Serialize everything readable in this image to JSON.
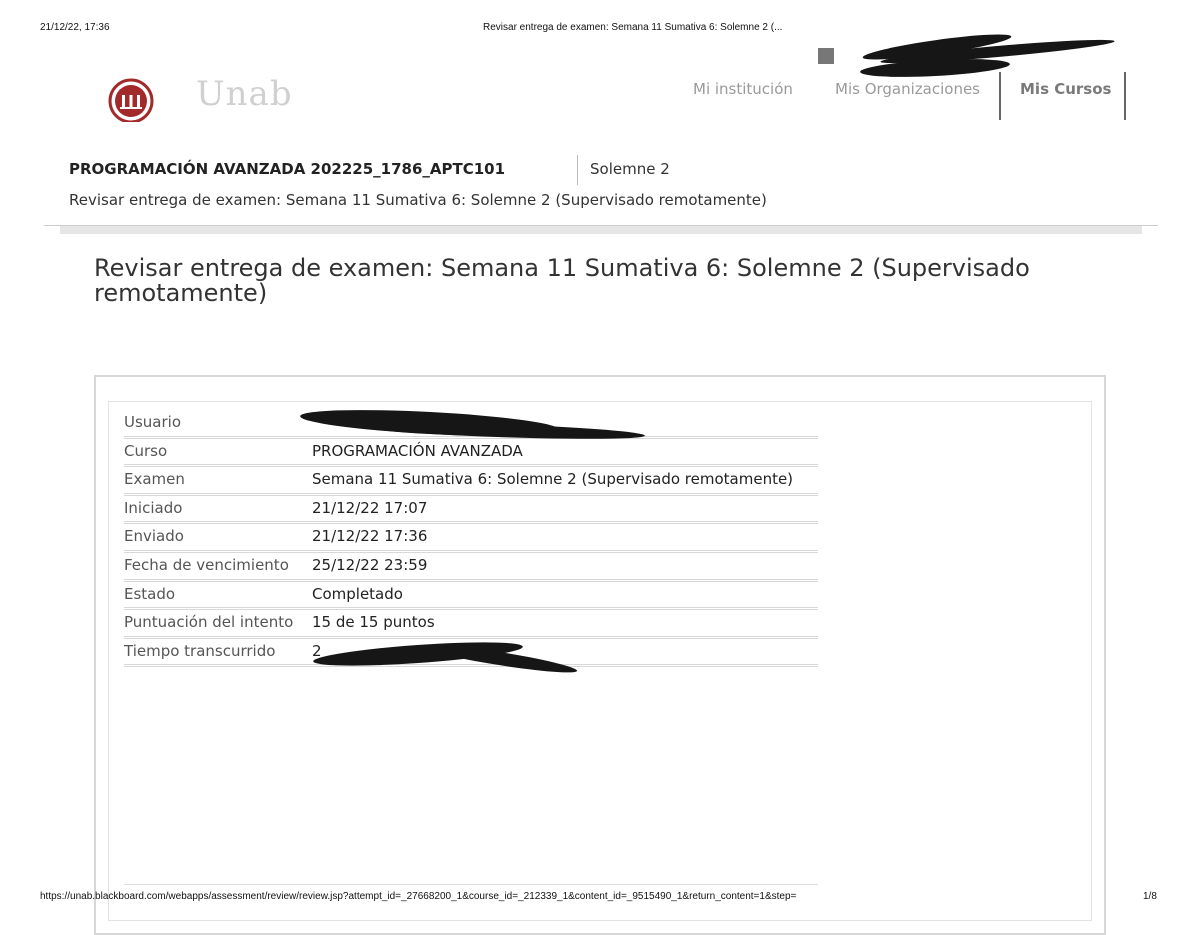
{
  "print": {
    "datetime": "21/12/22, 17:36",
    "title": "Revisar entrega de examen: Semana 11 Sumativa 6: Solemne 2 (...",
    "url": "https://unab.blackboard.com/webapps/assessment/review/review.jsp?attempt_id=_27668200_1&course_id=_212339_1&content_id=_9515490_1&return_content=1&step=",
    "page": "1/8"
  },
  "brand": {
    "logo_text": "Unab",
    "seal_color": "#a32a2a"
  },
  "nav": {
    "institution": "Mi institución",
    "organizations": "Mis Organizaciones",
    "courses": "Mis Cursos"
  },
  "breadcrumb": {
    "course": "PROGRAMACIÓN AVANZADA 202225_1786_APTC101",
    "item": "Solemne 2",
    "page": "Revisar entrega de examen: Semana 11 Sumativa 6: Solemne 2 (Supervisado remotamente)"
  },
  "page_title": "Revisar entrega de examen: Semana 11 Sumativa 6: Solemne 2 (Supervisado remotamente)",
  "details": [
    {
      "label": "Usuario",
      "value": ""
    },
    {
      "label": "Curso",
      "value": "PROGRAMACIÓN AVANZADA"
    },
    {
      "label": "Examen",
      "value": "Semana 11 Sumativa 6: Solemne 2 (Supervisado remotamente)"
    },
    {
      "label": "Iniciado",
      "value": "21/12/22 17:07"
    },
    {
      "label": "Enviado",
      "value": "21/12/22 17:36"
    },
    {
      "label": "Fecha de vencimiento",
      "value": "25/12/22 23:59"
    },
    {
      "label": "Estado",
      "value": "Completado"
    },
    {
      "label": "Puntuación del intento",
      "value": "15 de 15 puntos"
    },
    {
      "label": "Tiempo transcurrido",
      "value": "2"
    }
  ]
}
